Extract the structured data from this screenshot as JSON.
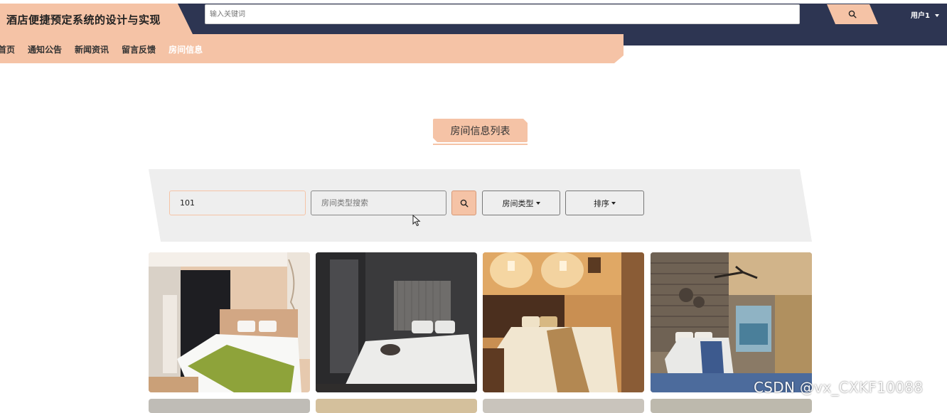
{
  "header": {
    "site_title": "酒店便捷预定系统的设计与实现",
    "search_placeholder": "输入关键词",
    "user_label": "用户1"
  },
  "nav": {
    "items": [
      {
        "label": "首页",
        "active": false
      },
      {
        "label": "通知公告",
        "active": false
      },
      {
        "label": "新闻资讯",
        "active": false
      },
      {
        "label": "留言反馈",
        "active": false
      },
      {
        "label": "房间信息",
        "active": true
      }
    ]
  },
  "section": {
    "title": "房间信息列表"
  },
  "filters": {
    "room_no_value": "101",
    "room_type_placeholder": "房间类型搜索",
    "type_dropdown_label": "房间类型",
    "sort_dropdown_label": "排序"
  },
  "rooms": [
    {
      "image": "room-photo-bright-green-bedspread"
    },
    {
      "image": "room-photo-dark-grey"
    },
    {
      "image": "room-photo-warm-lamps"
    },
    {
      "image": "room-photo-ocean-view-balcony"
    }
  ],
  "watermark": "CSDN @vx_CXKF10088",
  "colors": {
    "accent": "#f5c3a6",
    "topbar": "#2d3552",
    "filter_bg": "#eeeeee"
  }
}
